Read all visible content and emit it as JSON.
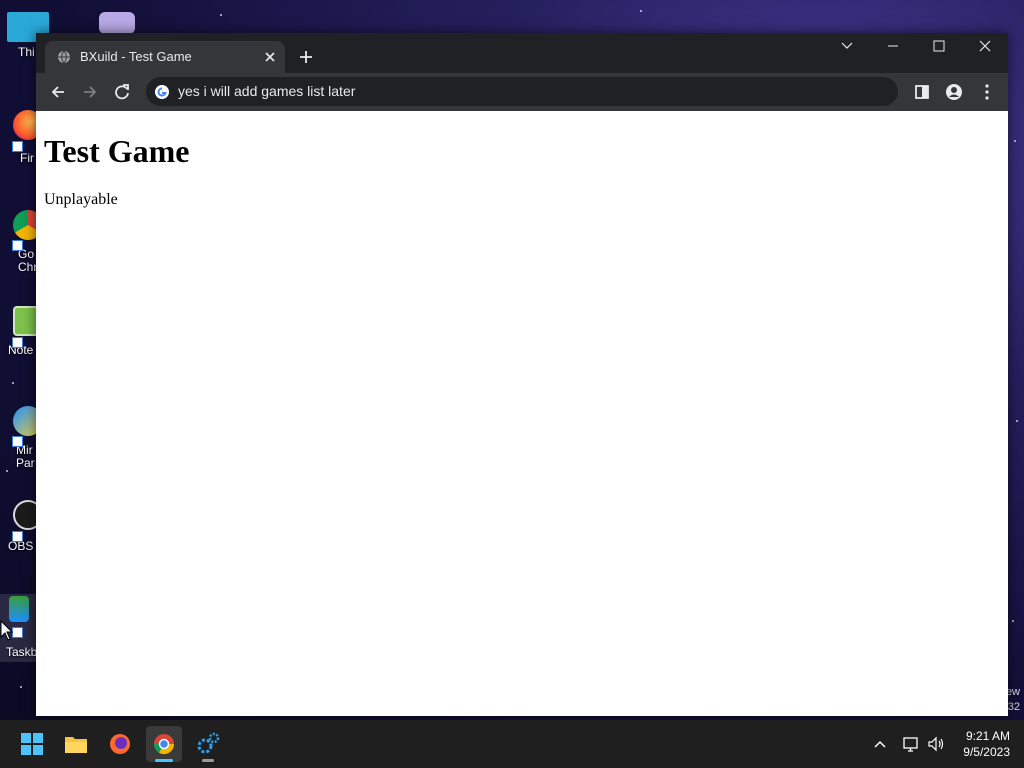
{
  "desktop": {
    "icons": [
      {
        "label": "Thi"
      },
      {
        "label": "Fir"
      },
      {
        "label": "Go\nChr"
      },
      {
        "label": "Note"
      },
      {
        "label": "Mir\nPar"
      },
      {
        "label": "OBS"
      },
      {
        "label": "Taskb"
      }
    ],
    "edge_text_1": "ew",
    "edge_text_2": "32"
  },
  "browser": {
    "tab_title": "BXuild - Test Game",
    "address": "yes i will add games list later",
    "page": {
      "heading": "Test Game",
      "body_text": "Unplayable"
    }
  },
  "taskbar": {
    "apps": [
      "start-icon",
      "file-explorer-icon",
      "firefox-icon",
      "chrome-icon",
      "settings-icon"
    ],
    "clock_time": "9:21 AM",
    "clock_date": "9/5/2023"
  },
  "colors": {
    "tab_active": "#35363a",
    "chrome_frame": "#202124",
    "taskbar": "#1f1f1f",
    "accent": "#4cc2ff"
  }
}
